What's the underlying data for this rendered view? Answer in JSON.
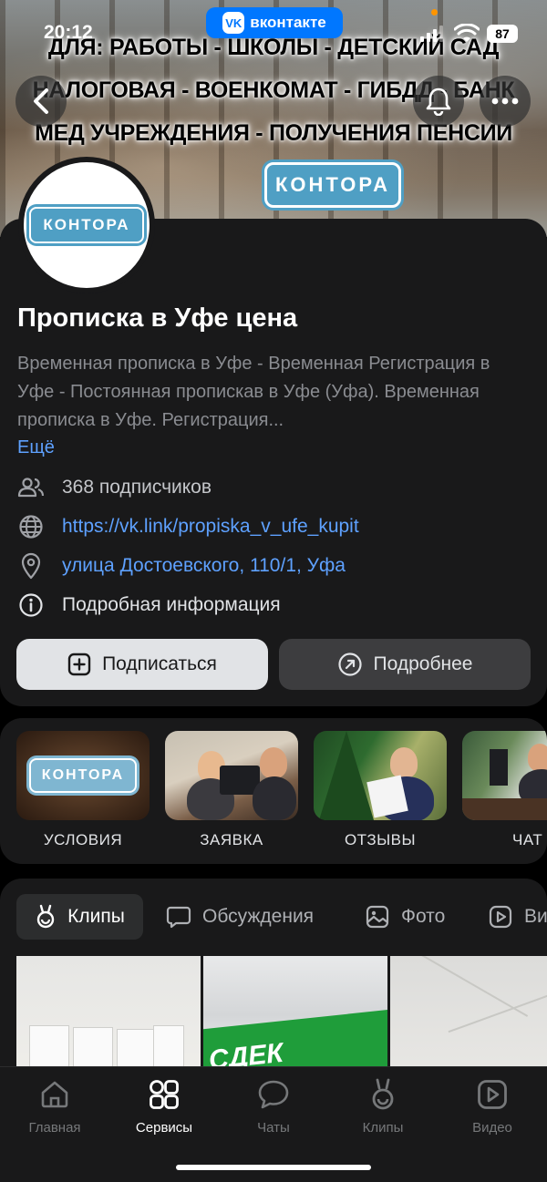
{
  "status_bar": {
    "time": "20:12",
    "app_badge": "вконтакте",
    "battery": "87"
  },
  "cover": {
    "line1": "ДЛЯ: РАБОТЫ - ШКОЛЫ - ДЕТСКИЙ САД",
    "line2": "НАЛОГОВАЯ - ВОЕНКОМАТ - ГИБДД - БАНК",
    "line3": "МЕД УЧРЕЖДЕНИЯ - ПОЛУЧЕНИЯ ПЕНСИИ",
    "sign": "КОНТОРА"
  },
  "profile": {
    "avatar_sign": "КОНТОРА",
    "title": "Прописка в Уфе цена",
    "description": "Временная прописка в Уфе - Временная Регистрация в Уфе - Постоянная пропискав в Уфе (Уфа). Временная прописка в Уфе. Регистрация...",
    "more": "Ещё",
    "subscribers": "368 подписчиков",
    "link": "https://vk.link/propiska_v_ufe_kupit",
    "address": "улица Достоевского, 110/1, Уфа",
    "details": "Подробная информация",
    "subscribe_label": "Подписаться",
    "more_label": "Подробнее"
  },
  "stories": [
    {
      "label": "УСЛОВИЯ",
      "sign": "КОНТОРА"
    },
    {
      "label": "ЗАЯВКА"
    },
    {
      "label": "ОТЗЫВЫ"
    },
    {
      "label": "ЧАТ"
    }
  ],
  "tabs": {
    "clips": "Клипы",
    "discussions": "Обсуждения",
    "photo": "Фото",
    "video": "Ви"
  },
  "grid": {
    "cdek_text": "СДЕК"
  },
  "tabbar": {
    "home": "Главная",
    "services": "Сервисы",
    "chats": "Чаты",
    "clips": "Клипы",
    "video": "Видео"
  },
  "colors": {
    "accent": "#5ea1ff",
    "vk_blue": "#0077ff",
    "card_bg": "#19191a",
    "sign_blue": "#4f9fc4"
  }
}
